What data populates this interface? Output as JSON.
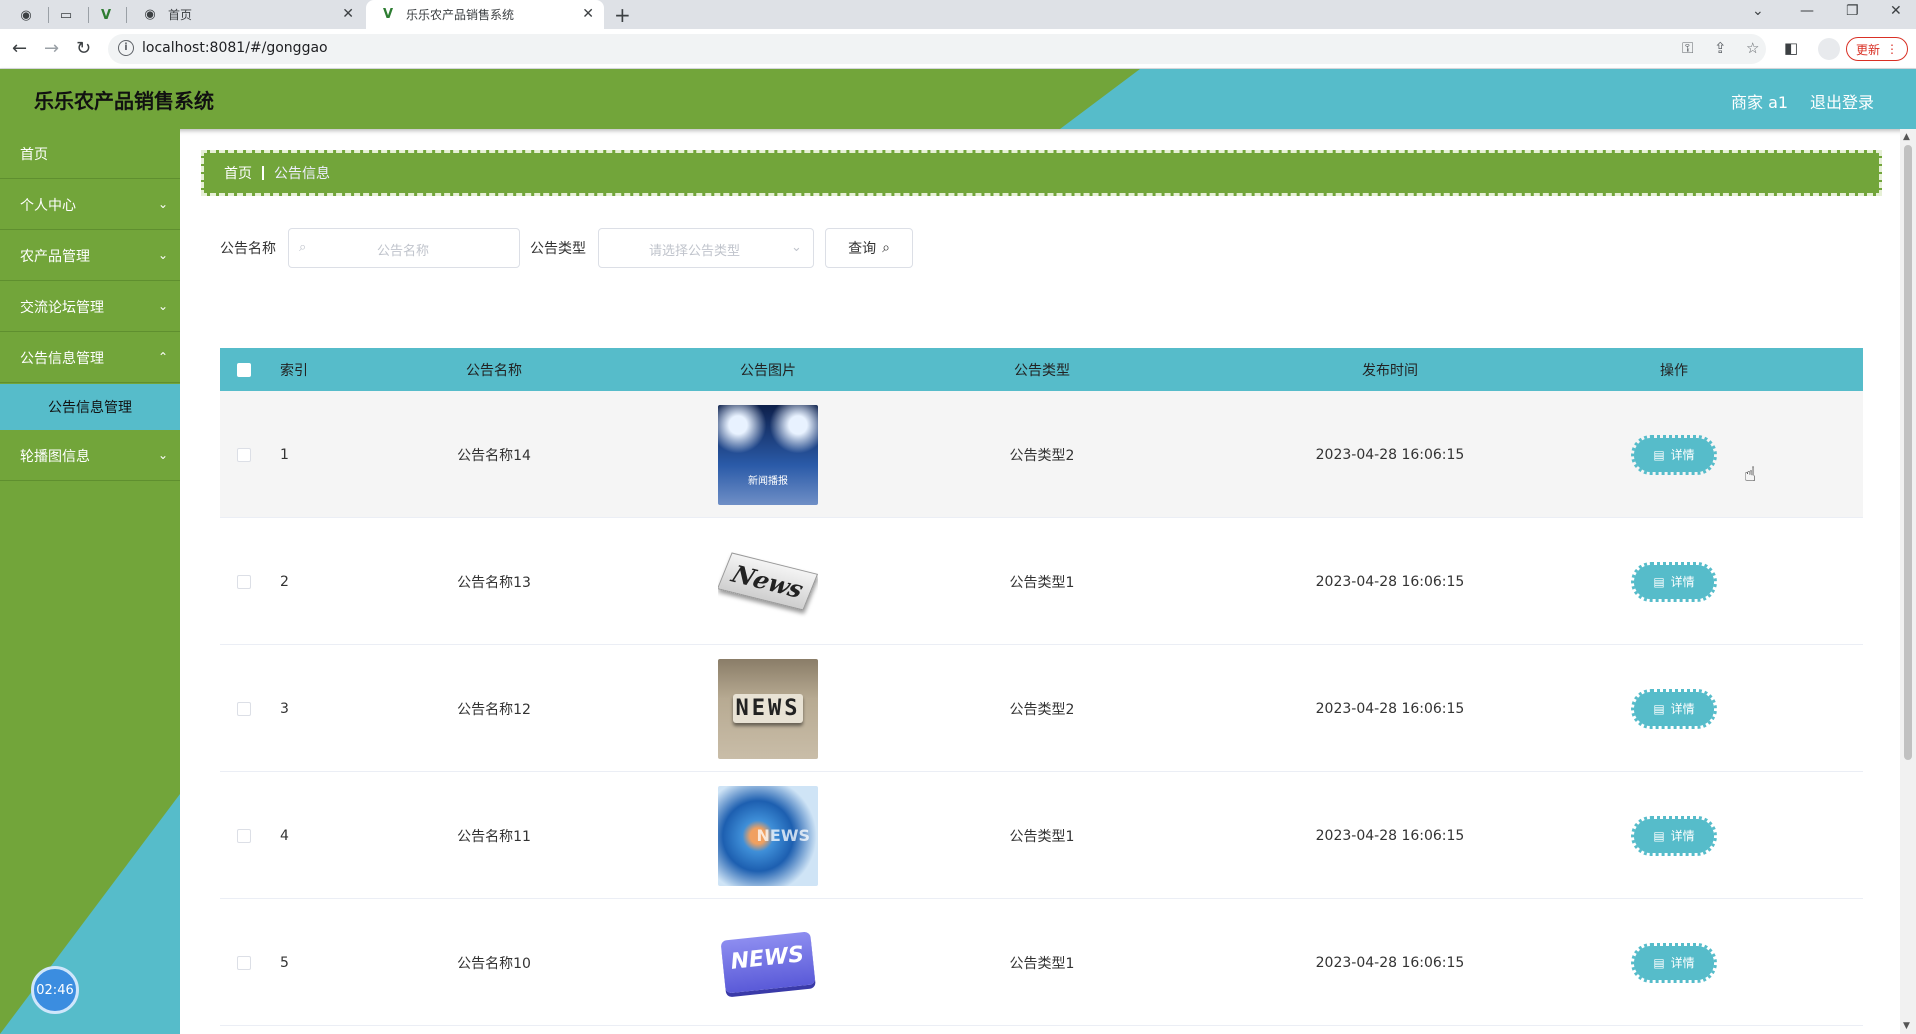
{
  "browser": {
    "tabs": [
      {
        "title": "首页"
      },
      {
        "title": "乐乐农产品销售系统"
      }
    ],
    "url": "localhost:8081/#/gonggao",
    "update_label": "更新"
  },
  "header": {
    "title": "乐乐农产品销售系统",
    "user": "商家 a1",
    "logout": "退出登录"
  },
  "sidebar": {
    "items": [
      {
        "label": "首页"
      },
      {
        "label": "个人中心"
      },
      {
        "label": "农产品管理"
      },
      {
        "label": "交流论坛管理"
      },
      {
        "label": "公告信息管理"
      },
      {
        "label": "轮播图信息"
      }
    ],
    "sub_item": "公告信息管理",
    "clock": "02:46"
  },
  "breadcrumb": {
    "home": "首页",
    "current": "公告信息"
  },
  "search": {
    "name_label": "公告名称",
    "name_placeholder": "公告名称",
    "type_label": "公告类型",
    "type_placeholder": "请选择公告类型",
    "query_button": "查询"
  },
  "table": {
    "columns": [
      "索引",
      "公告名称",
      "公告图片",
      "公告类型",
      "发布时间",
      "操作"
    ],
    "rows": [
      {
        "index": "1",
        "name": "公告名称14",
        "type": "公告类型2",
        "time": "2023-04-28 16:06:15",
        "action": "详情",
        "image_caption": "新闻播报"
      },
      {
        "index": "2",
        "name": "公告名称13",
        "type": "公告类型1",
        "time": "2023-04-28 16:06:15",
        "action": "详情",
        "image_caption": "News"
      },
      {
        "index": "3",
        "name": "公告名称12",
        "type": "公告类型2",
        "time": "2023-04-28 16:06:15",
        "action": "详情",
        "image_caption": "NEWS"
      },
      {
        "index": "4",
        "name": "公告名称11",
        "type": "公告类型1",
        "time": "2023-04-28 16:06:15",
        "action": "详情",
        "image_caption": "NEWS"
      },
      {
        "index": "5",
        "name": "公告名称10",
        "type": "公告类型1",
        "time": "2023-04-28 16:06:15",
        "action": "详情",
        "image_caption": "NEWS"
      }
    ]
  }
}
